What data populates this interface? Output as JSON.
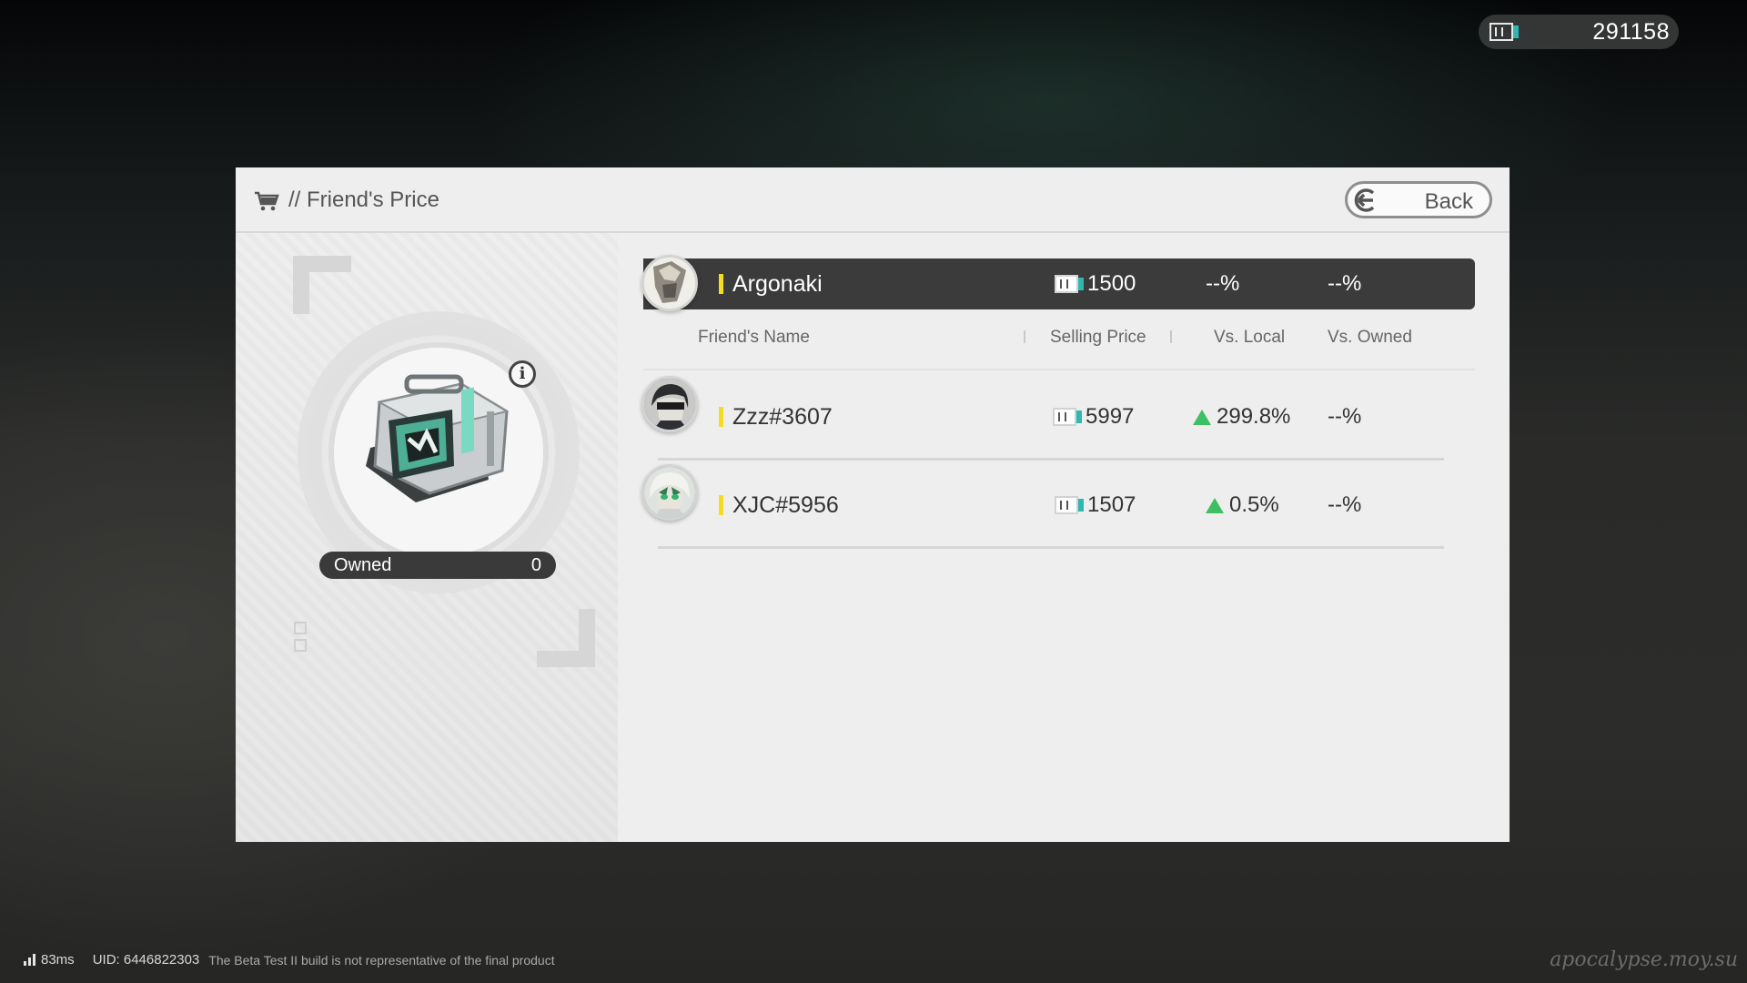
{
  "wallet": {
    "amount": "291158",
    "icon": "currency-battery-icon"
  },
  "panel": {
    "title": "// Friend's Price",
    "back_label": "Back"
  },
  "item": {
    "owned_label": "Owned",
    "owned_count": "0",
    "info_label": "i"
  },
  "columns": {
    "name": "Friend's Name",
    "price": "Selling Price",
    "vs_local": "Vs. Local",
    "vs_owned": "Vs. Owned"
  },
  "self_row": {
    "name": "Argonaki",
    "price": "1500",
    "vs_local": "--%",
    "vs_owned": "--%"
  },
  "rows": [
    {
      "name": "Zzz#3607",
      "price": "5997",
      "vs_local": "299.8%",
      "vs_owned": "--%"
    },
    {
      "name": "XJC#5956",
      "price": "1507",
      "vs_local": "0.5%",
      "vs_owned": "--%"
    }
  ],
  "footer": {
    "ping": "83ms",
    "uid": "UID: 6446822303",
    "notice": "The Beta Test II build is not representative of the final product",
    "watermark": "apocalypse.moy.su"
  },
  "colors": {
    "accent_yellow": "#f5dc22",
    "up_green": "#3dc063",
    "teal": "#2fb8b0",
    "dark_row": "#3b3b3b"
  }
}
